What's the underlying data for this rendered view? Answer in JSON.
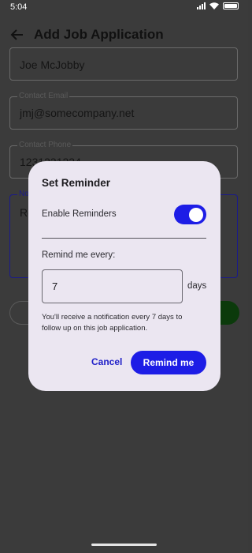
{
  "status_bar": {
    "time": "5:04",
    "icons": [
      "signal-icon",
      "wifi-icon",
      "battery-icon"
    ]
  },
  "app_bar": {
    "title": "Add Job Application",
    "back_icon": "arrow-left-icon"
  },
  "form": {
    "name_value": "Joe McJobby",
    "email_label": "Contact Email",
    "email_value": "jmj@somecompany.net",
    "phone_label": "Contact Phone",
    "phone_value": "1231231234",
    "notes_label": "No",
    "notes_value": "Re"
  },
  "dialog": {
    "title": "Set Reminder",
    "enable_label": "Enable Reminders",
    "enable_on": true,
    "remind_label": "Remind me every:",
    "interval_value": "7",
    "unit_label": "days",
    "info_text": "You'll receive a notification every 7 days to follow up on this job application.",
    "cancel_label": "Cancel",
    "confirm_label": "Remind me"
  },
  "colors": {
    "accent": "#1d1de6",
    "dialog_bg": "#ebe6f1",
    "scrim": "#3b3b3b"
  }
}
